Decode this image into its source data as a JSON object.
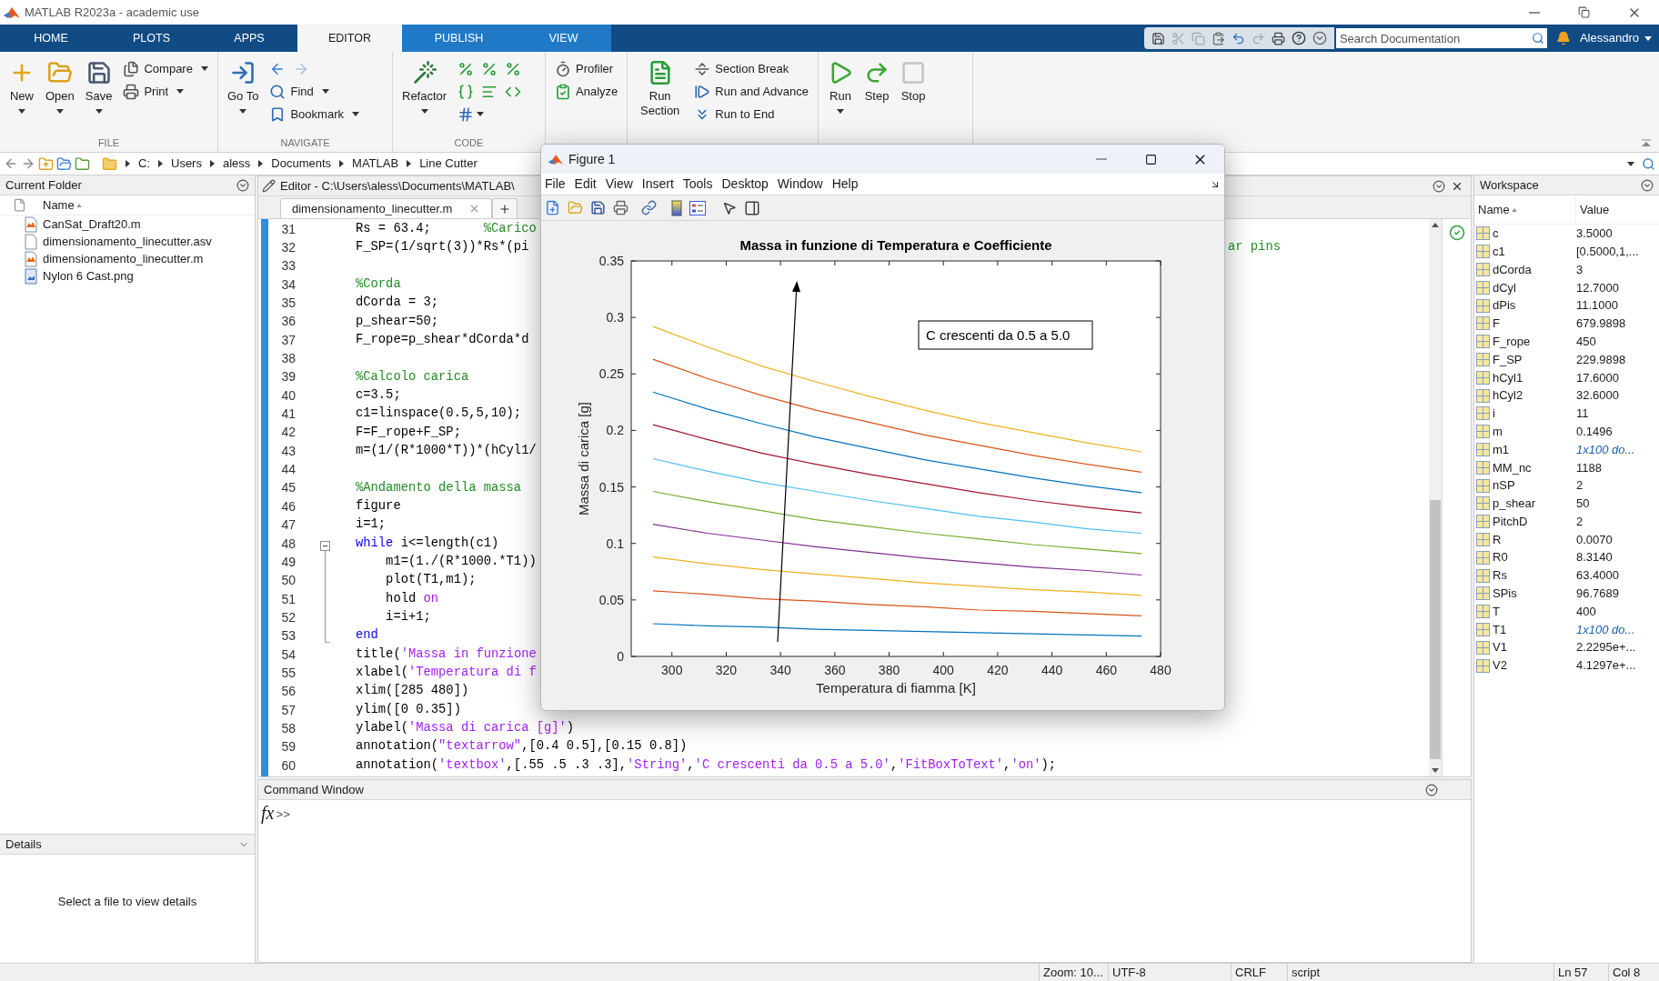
{
  "window": {
    "title": "MATLAB R2023a - academic use"
  },
  "tabs": [
    {
      "label": "HOME",
      "selected": false,
      "kind": "main"
    },
    {
      "label": "PLOTS",
      "selected": false,
      "kind": "main"
    },
    {
      "label": "APPS",
      "selected": false,
      "kind": "main"
    },
    {
      "label": "EDITOR",
      "selected": true,
      "kind": "context"
    },
    {
      "label": "PUBLISH",
      "selected": false,
      "kind": "context"
    },
    {
      "label": "VIEW",
      "selected": false,
      "kind": "context"
    }
  ],
  "search": {
    "placeholder": "Search Documentation"
  },
  "user": "Alessandro",
  "toolstrip": [
    {
      "label": "FILE",
      "buttons": [
        {
          "label": "New",
          "kind": "big",
          "has_menu": true
        },
        {
          "label": "Open",
          "kind": "big",
          "has_menu": true
        },
        {
          "label": "Save",
          "kind": "big",
          "has_menu": true
        },
        {
          "label": "Compare",
          "kind": "small",
          "has_menu": true
        },
        {
          "label": "Print",
          "kind": "small",
          "has_menu": true
        }
      ]
    },
    {
      "label": "NAVIGATE",
      "buttons": [
        {
          "label": "Go To",
          "kind": "big",
          "has_menu": true
        },
        {
          "kind": "icon",
          "has_menu": false
        },
        {
          "kind": "icon",
          "has_menu": false
        },
        {
          "label": "Find",
          "kind": "small",
          "has_menu": true
        },
        {
          "label": "Bookmark",
          "kind": "small",
          "has_menu": true
        }
      ]
    },
    {
      "label": "CODE",
      "buttons": [
        {
          "label": "Refactor",
          "kind": "big",
          "has_menu": true
        },
        {
          "kind": "icon",
          "has_menu": false
        },
        {
          "kind": "icon",
          "has_menu": false
        },
        {
          "kind": "icon",
          "has_menu": false
        },
        {
          "kind": "icon",
          "has_menu": false
        },
        {
          "kind": "icon",
          "has_menu": false
        },
        {
          "kind": "icon",
          "has_menu": false
        },
        {
          "kind": "icon",
          "has_menu": true
        }
      ]
    },
    {
      "buttons": [
        {
          "label": "Profiler",
          "kind": "small",
          "has_menu": false
        },
        {
          "label": "Analyze",
          "kind": "small",
          "has_menu": false
        }
      ]
    },
    {
      "buttons": [
        {
          "label": "Run Section",
          "kind": "big",
          "has_menu": false
        },
        {
          "label": "Section Break",
          "kind": "small",
          "has_menu": false
        },
        {
          "label": "Run and Advance",
          "kind": "small",
          "has_menu": false
        },
        {
          "label": "Run to End",
          "kind": "small",
          "has_menu": false
        }
      ]
    },
    {
      "buttons": [
        {
          "label": "Run",
          "kind": "big",
          "has_menu": true,
          "disabled": false
        },
        {
          "label": "Step",
          "kind": "big",
          "has_menu": false,
          "disabled": false
        },
        {
          "label": "Stop",
          "kind": "big",
          "has_menu": false,
          "disabled": true
        }
      ]
    }
  ],
  "address_bar": {
    "path": [
      "C:",
      "Users",
      "aless",
      "Documents",
      "MATLAB",
      "Line Cutter"
    ]
  },
  "current_folder": {
    "title": "Current Folder",
    "column": "Name",
    "files": [
      {
        "name": "CanSat_Draft20.m",
        "kind": "mfile"
      },
      {
        "name": "dimensionamento_linecutter.asv",
        "kind": "document"
      },
      {
        "name": "dimensionamento_linecutter.m",
        "kind": "mfile"
      },
      {
        "name": "Nylon 6 Cast.png",
        "kind": "image"
      }
    ]
  },
  "details": {
    "title": "Details",
    "message": "Select a file to view details"
  },
  "editor": {
    "title": "Editor - C:\\Users\\aless\\Documents\\MATLAB\\",
    "tabs": [
      {
        "label": "dimensionamento_linecutter.m",
        "selected": true
      }
    ],
    "lines": [
      {
        "number": "31",
        "segments": [
          {
            "kind": "plain",
            "text": "Rs = 63.4;       "
          },
          {
            "kind": "comment",
            "text": "%Carico"
          }
        ]
      },
      {
        "number": "32",
        "segments": [
          {
            "kind": "plain",
            "text": "F_SP=(1/sqrt(3))*Rs*(pi"
          }
        ],
        "tail": {
          "kind": "comment",
          "text": "ar pins"
        }
      },
      {
        "number": "33"
      },
      {
        "number": "34",
        "segments": [
          {
            "kind": "comment",
            "text": "%Corda"
          }
        ]
      },
      {
        "number": "35",
        "segments": [
          {
            "kind": "plain",
            "text": "dCorda = 3;"
          }
        ]
      },
      {
        "number": "36",
        "segments": [
          {
            "kind": "plain",
            "text": "p_shear=50;"
          }
        ]
      },
      {
        "number": "37",
        "segments": [
          {
            "kind": "plain",
            "text": "F_rope=p_shear*dCorda*d"
          }
        ]
      },
      {
        "number": "38"
      },
      {
        "number": "39",
        "segments": [
          {
            "kind": "comment",
            "text": "%Calcolo carica"
          }
        ]
      },
      {
        "number": "40",
        "segments": [
          {
            "kind": "plain",
            "text": "c=3.5;"
          }
        ]
      },
      {
        "number": "41",
        "segments": [
          {
            "kind": "plain",
            "text": "c1=linspace(0.5,5,10);"
          }
        ]
      },
      {
        "number": "42",
        "segments": [
          {
            "kind": "plain",
            "text": "F=F_rope+F_SP;"
          }
        ]
      },
      {
        "number": "43",
        "segments": [
          {
            "kind": "plain",
            "text": "m=(1/(R*1000*T))*(hCyl1/"
          }
        ]
      },
      {
        "number": "44"
      },
      {
        "number": "45",
        "segments": [
          {
            "kind": "comment",
            "text": "%Andamento della massa"
          }
        ]
      },
      {
        "number": "46",
        "segments": [
          {
            "kind": "plain",
            "text": "figure"
          }
        ]
      },
      {
        "number": "47",
        "segments": [
          {
            "kind": "plain",
            "text": "i=1;"
          }
        ]
      },
      {
        "number": "48",
        "segments": [
          {
            "kind": "keyword",
            "text": "while"
          },
          {
            "kind": "plain",
            "text": " i<=length(c1)"
          }
        ]
      },
      {
        "number": "49",
        "segments": [
          {
            "kind": "plain",
            "text": "    m1=(1./(R*1000.*T1))"
          }
        ]
      },
      {
        "number": "50",
        "segments": [
          {
            "kind": "plain",
            "text": "    plot(T1,m1);"
          }
        ]
      },
      {
        "number": "51",
        "segments": [
          {
            "kind": "plain",
            "text": "    hold "
          },
          {
            "kind": "string",
            "text": "on"
          }
        ]
      },
      {
        "number": "52",
        "segments": [
          {
            "kind": "plain",
            "text": "    i=i+1;"
          }
        ]
      },
      {
        "number": "53",
        "segments": [
          {
            "kind": "keyword",
            "text": "end"
          }
        ]
      },
      {
        "number": "54",
        "segments": [
          {
            "kind": "plain",
            "text": "title("
          },
          {
            "kind": "string",
            "text": "'Massa in funzione"
          }
        ]
      },
      {
        "number": "55",
        "segments": [
          {
            "kind": "plain",
            "text": "xlabel("
          },
          {
            "kind": "string",
            "text": "'Temperatura di f"
          }
        ]
      },
      {
        "number": "56",
        "segments": [
          {
            "kind": "plain",
            "text": "xlim([285 480])"
          }
        ]
      },
      {
        "number": "57",
        "segments": [
          {
            "kind": "plain",
            "text": "ylim([0 0.35])"
          }
        ]
      },
      {
        "number": "58",
        "segments": [
          {
            "kind": "plain",
            "text": "ylabel("
          },
          {
            "kind": "string",
            "text": "'Massa di carica [g]'"
          },
          {
            "kind": "plain",
            "text": ")"
          }
        ]
      },
      {
        "number": "59",
        "segments": [
          {
            "kind": "plain",
            "text": "annotation("
          },
          {
            "kind": "string",
            "text": "\"textarrow\""
          },
          {
            "kind": "plain",
            "text": ",[0.4 0.5],[0.15 0.8])"
          }
        ]
      },
      {
        "number": "60",
        "segments": [
          {
            "kind": "plain",
            "text": "annotation("
          },
          {
            "kind": "string",
            "text": "'textbox'"
          },
          {
            "kind": "plain",
            "text": ",[.55 .5 .3 .3],"
          },
          {
            "kind": "string",
            "text": "'String'"
          },
          {
            "kind": "plain",
            "text": ","
          },
          {
            "kind": "string",
            "text": "'C crescenti da 0.5 a 5.0'"
          },
          {
            "kind": "plain",
            "text": ","
          },
          {
            "kind": "string",
            "text": "'FitBoxToText'"
          },
          {
            "kind": "plain",
            "text": ","
          },
          {
            "kind": "string",
            "text": "'on'"
          },
          {
            "kind": "plain",
            "text": ");"
          }
        ]
      }
    ]
  },
  "command_window": {
    "title": "Command Window",
    "fx": "fx",
    "prompt": ">>"
  },
  "workspace": {
    "title": "Workspace",
    "columns": [
      "Name",
      "Value"
    ],
    "variables": [
      {
        "name": "c",
        "value": "3.5000",
        "kind": "value"
      },
      {
        "name": "c1",
        "value": "[0.5000,1,...",
        "kind": "value"
      },
      {
        "name": "dCorda",
        "value": "3",
        "kind": "value"
      },
      {
        "name": "dCyl",
        "value": "12.7000",
        "kind": "value"
      },
      {
        "name": "dPis",
        "value": "11.1000",
        "kind": "value"
      },
      {
        "name": "F",
        "value": "679.9898",
        "kind": "value"
      },
      {
        "name": "F_rope",
        "value": "450",
        "kind": "value"
      },
      {
        "name": "F_SP",
        "value": "229.9898",
        "kind": "value"
      },
      {
        "name": "hCyl1",
        "value": "17.6000",
        "kind": "value"
      },
      {
        "name": "hCyl2",
        "value": "32.6000",
        "kind": "value"
      },
      {
        "name": "i",
        "value": "11",
        "kind": "value"
      },
      {
        "name": "m",
        "value": "0.1496",
        "kind": "value"
      },
      {
        "name": "m1",
        "value": "1x100 do...",
        "kind": "summary"
      },
      {
        "name": "MM_nc",
        "value": "1188",
        "kind": "value"
      },
      {
        "name": "nSP",
        "value": "2",
        "kind": "value"
      },
      {
        "name": "p_shear",
        "value": "50",
        "kind": "value"
      },
      {
        "name": "PitchD",
        "value": "2",
        "kind": "value"
      },
      {
        "name": "R",
        "value": "0.0070",
        "kind": "value"
      },
      {
        "name": "R0",
        "value": "8.3140",
        "kind": "value"
      },
      {
        "name": "Rs",
        "value": "63.4000",
        "kind": "value"
      },
      {
        "name": "SPis",
        "value": "96.7689",
        "kind": "value"
      },
      {
        "name": "T",
        "value": "400",
        "kind": "value"
      },
      {
        "name": "T1",
        "value": "1x100 do...",
        "kind": "summary"
      },
      {
        "name": "V1",
        "value": "2.2295e+...",
        "kind": "value"
      },
      {
        "name": "V2",
        "value": "4.1297e+...",
        "kind": "value"
      }
    ]
  },
  "figure": {
    "title": "Figure 1",
    "menus": [
      "File",
      "Edit",
      "View",
      "Insert",
      "Tools",
      "Desktop",
      "Window",
      "Help"
    ],
    "chart_data": {
      "type": "line",
      "title": "Massa in funzione di Temperatura e Coefficiente",
      "xlabel": "Temperatura di fiamma [K]",
      "ylabel": "Massa di carica [g]",
      "x": [
        293,
        313,
        333,
        353,
        373,
        393,
        413,
        433,
        453,
        473
      ],
      "series": [
        {
          "color": "#0072bd",
          "values": [
            0.029,
            0.027,
            0.026,
            0.024,
            0.023,
            0.022,
            0.021,
            0.02,
            0.019,
            0.018
          ]
        },
        {
          "color": "#d95319",
          "values": [
            0.058,
            0.055,
            0.051,
            0.049,
            0.046,
            0.044,
            0.041,
            0.04,
            0.038,
            0.036
          ]
        },
        {
          "color": "#edb120",
          "values": [
            0.088,
            0.082,
            0.077,
            0.073,
            0.069,
            0.065,
            0.062,
            0.059,
            0.057,
            0.054
          ]
        },
        {
          "color": "#7e2f8e",
          "values": [
            0.117,
            0.109,
            0.103,
            0.097,
            0.092,
            0.087,
            0.083,
            0.079,
            0.076,
            0.072
          ]
        },
        {
          "color": "#77ac30",
          "values": [
            0.146,
            0.137,
            0.129,
            0.121,
            0.115,
            0.109,
            0.104,
            0.099,
            0.095,
            0.091
          ]
        },
        {
          "color": "#4dbeee",
          "values": [
            0.175,
            0.164,
            0.154,
            0.146,
            0.138,
            0.131,
            0.124,
            0.119,
            0.113,
            0.109
          ]
        },
        {
          "color": "#a2142f",
          "values": [
            0.205,
            0.192,
            0.18,
            0.17,
            0.161,
            0.153,
            0.145,
            0.138,
            0.132,
            0.127
          ]
        },
        {
          "color": "#0072bd",
          "values": [
            0.234,
            0.219,
            0.206,
            0.194,
            0.184,
            0.174,
            0.166,
            0.158,
            0.151,
            0.145
          ]
        },
        {
          "color": "#d95319",
          "values": [
            0.263,
            0.246,
            0.231,
            0.218,
            0.207,
            0.196,
            0.187,
            0.178,
            0.17,
            0.163
          ]
        },
        {
          "color": "#edb120",
          "values": [
            0.292,
            0.274,
            0.257,
            0.243,
            0.23,
            0.218,
            0.207,
            0.198,
            0.189,
            0.181
          ]
        }
      ],
      "xlim": [
        285,
        480
      ],
      "ylim": [
        0,
        0.35
      ],
      "xticks": [
        300,
        320,
        340,
        360,
        380,
        400,
        420,
        440,
        460,
        480
      ],
      "yticks": [
        0,
        {
          "value": 0.05,
          "label": "0.05"
        },
        {
          "value": 0.1,
          "label": "0.1"
        },
        {
          "value": 0.15,
          "label": "0.15"
        },
        {
          "value": 0.2,
          "label": "0.2"
        },
        {
          "value": 0.25,
          "label": "0.25"
        },
        {
          "value": 0.3,
          "label": "0.3"
        },
        {
          "value": 0.35,
          "label": "0.35"
        }
      ],
      "annotations": [
        "C crescenti da 0.5 a 5.0"
      ]
    }
  },
  "status_bar": [
    "Zoom: 10...",
    "UTF-8",
    "CRLF",
    "script",
    "Ln 57",
    "Col 8"
  ]
}
